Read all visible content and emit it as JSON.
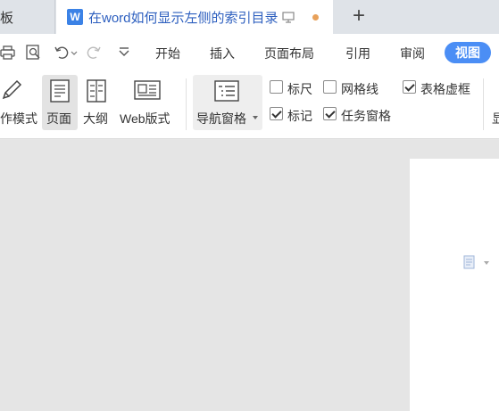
{
  "tabs": {
    "prev_label": "板",
    "active_title": "在word如何显示左侧的索引目录",
    "logo": "W"
  },
  "new_tab": "+",
  "menu": {
    "items": [
      "开始",
      "插入",
      "页面布局",
      "引用",
      "审阅"
    ],
    "active": "视图"
  },
  "ribbon": {
    "edit_mode": "作模式",
    "page": "页面",
    "outline": "大纲",
    "web": "Web版式",
    "nav_pane": "导航窗格",
    "ruler": "标尺",
    "gridlines": "网格线",
    "table_grid": "表格虚框",
    "marks": "标记",
    "task_pane": "任务窗格",
    "truncated": "显"
  },
  "checkboxes": {
    "ruler": false,
    "gridlines": false,
    "table_grid": true,
    "marks": true,
    "task_pane": true
  },
  "colors": {
    "accent": "#4b8ef5",
    "modified_dot": "#e8a15a",
    "tab_title": "#2d5fbf"
  }
}
